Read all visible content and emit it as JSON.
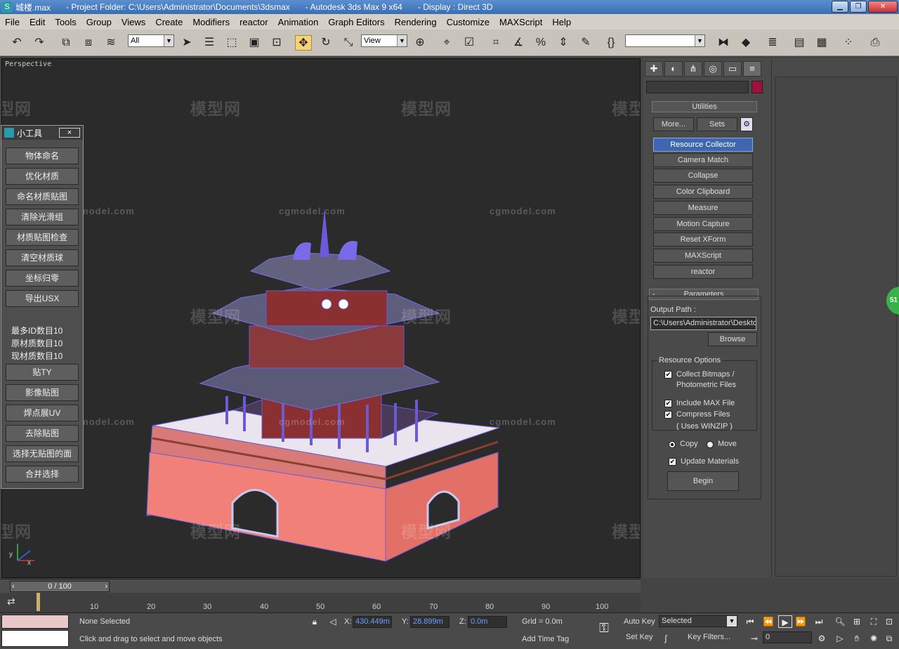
{
  "titlebar": {
    "file": "城楼.max",
    "project": "- Project Folder: C:\\Users\\Administrator\\Documents\\3dsmax",
    "app": "- Autodesk 3ds Max 9 x64",
    "display": "- Display : Direct 3D"
  },
  "menu": [
    "File",
    "Edit",
    "Tools",
    "Group",
    "Views",
    "Create",
    "Modifiers",
    "reactor",
    "Animation",
    "Graph Editors",
    "Rendering",
    "Customize",
    "MAXScript",
    "Help"
  ],
  "toolbar": {
    "selection_filter": "All",
    "ref_coord": "View"
  },
  "viewport": {
    "label": "Perspective",
    "axis_x": "x",
    "axis_y": "y"
  },
  "watermark": {
    "logo": "模型网",
    "site": "cgmodel.com"
  },
  "floater": {
    "title": "小工具",
    "close": "×",
    "buttons_top": [
      "物体命名",
      "优化材质",
      "命名材质贴图",
      "清除光滑组",
      "材质贴图检查",
      "清空材质球",
      "坐标归零",
      "导出USX"
    ],
    "stats": [
      "最多ID数目10",
      "原材质数目10",
      "现材质数目10"
    ],
    "buttons_bottom": [
      "贴TY",
      "影像贴图",
      "焊点展UV",
      "去除贴图",
      "选择无贴图的面",
      "合并选择"
    ]
  },
  "command_panel": {
    "utilities_title": "Utilities",
    "more": "More...",
    "sets": "Sets",
    "utilities": [
      "Resource Collector",
      "Camera Match",
      "Collapse",
      "Color Clipboard",
      "Measure",
      "Motion Capture",
      "Reset XForm",
      "MAXScript",
      "reactor"
    ],
    "parameters_title": "Parameters",
    "output_path_label": "Output Path :",
    "output_path": "C:\\Users\\Administrator\\Deskto",
    "browse": "Browse",
    "resource_options": "Resource Options",
    "collect_bitmaps_1": "Collect Bitmaps /",
    "collect_bitmaps_2": "Photometric Files",
    "include_max": "Include MAX File",
    "compress_1": "Compress Files",
    "compress_2": "( Uses WINZIP )",
    "copy": "Copy",
    "move": "Move",
    "update_materials": "Update Materials",
    "begin": "Begin"
  },
  "timeslider": {
    "frame": "0 / 100"
  },
  "trackbar": {
    "ticks": [
      "10",
      "20",
      "30",
      "40",
      "50",
      "60",
      "70",
      "80",
      "90",
      "100"
    ]
  },
  "status": {
    "selection": "None Selected",
    "prompt": "Click and drag to select and move objects",
    "x_label": "X:",
    "x": "430.449m",
    "y_label": "Y:",
    "y": "28.899m",
    "z_label": "Z:",
    "z": "0.0m",
    "grid": "Grid = 0.0m",
    "add_time_tag": "Add Time Tag",
    "auto_key": "Auto Key",
    "set_key": "Set Key",
    "selected": "Selected",
    "key_filters": "Key Filters...",
    "frame_field": "0"
  },
  "badge": "51"
}
